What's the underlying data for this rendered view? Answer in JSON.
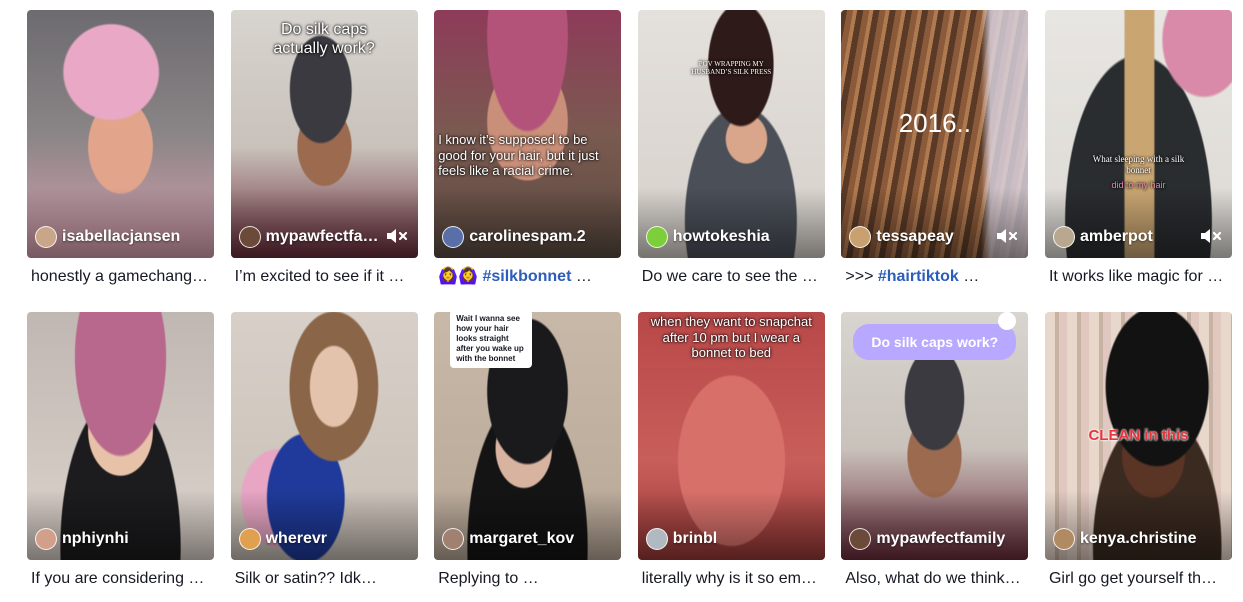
{
  "videos": [
    {
      "username": "isabellacjansen",
      "caption": "honestly a gamechang…",
      "muted": false
    },
    {
      "username": "mypawfectfa…",
      "caption": "I’m excited to see if it …",
      "muted": true,
      "overlay": "Do silk caps actually work?"
    },
    {
      "username": "carolinespam.2",
      "caption_emoji": "🙆‍♀️🙆‍♀️",
      "caption_tag": "#silkbonnet",
      "caption_rest": " …",
      "muted": false,
      "overlay": "I know it’s supposed to be good for your hair, but it just feels like a racial crime."
    },
    {
      "username": "howtokeshia",
      "caption": "Do we care to see the …",
      "muted": false,
      "overlay": "POV WRAPPING MY HUSBAND’S SILK PRESS"
    },
    {
      "username": "tessapeay",
      "caption_prefix": ">>> ",
      "caption_tag": "#hairtiktok",
      "caption_rest": " …",
      "muted": true,
      "overlay": "2016.."
    },
    {
      "username": "amberpot",
      "caption": "It works like magic for …",
      "muted": true,
      "overlay": "What sleeping with a silk bonnet",
      "overlay2": "did to my hair"
    },
    {
      "username": "nphiynhi",
      "caption": "If you are considering …",
      "muted": false
    },
    {
      "username": "wherevr",
      "caption": "Silk or satin?? Idk…",
      "muted": false
    },
    {
      "username": "margaret_kov",
      "caption": "Replying to …",
      "muted": false,
      "reply": "Wait I wanna see how your hair looks straight after you wake up with the bonnet"
    },
    {
      "username": "brinbl",
      "caption": "literally why is it so em…",
      "muted": false,
      "overlay": "when they want to snapchat after 10 pm but I wear a bonnet to bed"
    },
    {
      "username": "mypawfectfamily",
      "caption": "Also, what do we think…",
      "muted": false,
      "bubble": "Do silk caps work?"
    },
    {
      "username": "kenya.christine",
      "caption": "Girl go get yourself th…",
      "muted": false,
      "overlay": "CLEAN in this"
    }
  ]
}
